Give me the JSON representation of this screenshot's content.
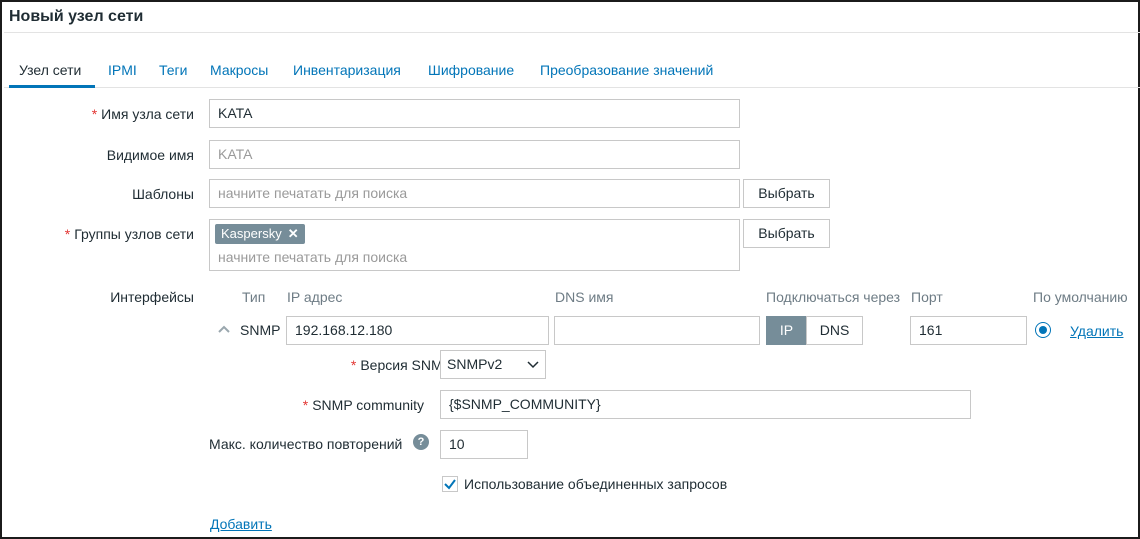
{
  "page": {
    "title": "Новый узел сети"
  },
  "tabs": [
    {
      "label": "Узел сети"
    },
    {
      "label": "IPMI"
    },
    {
      "label": "Теги"
    },
    {
      "label": "Макросы"
    },
    {
      "label": "Инвентаризация"
    },
    {
      "label": "Шифрование"
    },
    {
      "label": "Преобразование значений"
    }
  ],
  "form": {
    "required_mark": "*",
    "hostname": {
      "label": "Имя узла сети",
      "value": "KATA"
    },
    "visible_name": {
      "label": "Видимое имя",
      "placeholder": "KATA"
    },
    "templates": {
      "label": "Шаблоны",
      "placeholder": "начните печатать для поиска",
      "select_label": "Выбрать"
    },
    "groups": {
      "label": "Группы узлов сети",
      "chip": "Kaspersky",
      "chip_remove": "✕",
      "placeholder": "начните печатать для поиска",
      "select_label": "Выбрать"
    },
    "interfaces": {
      "label": "Интерфейсы",
      "headers": {
        "type": "Тип",
        "ip": "IP адрес",
        "dns": "DNS имя",
        "connect": "Подключаться через",
        "port": "Порт",
        "default": "По умолчанию"
      },
      "row": {
        "type": "SNMP",
        "ip": "192.168.12.180",
        "dns": "",
        "connect_ip": "IP",
        "connect_dns": "DNS",
        "port": "161",
        "remove": "Удалить"
      },
      "snmp_version": {
        "label": "Версия SNMP",
        "value": "SNMPv2"
      },
      "snmp_community": {
        "label": "SNMP community",
        "value": "{$SNMP_COMMUNITY}"
      },
      "max_repetitions": {
        "label": "Макс. количество повторений",
        "value": "10",
        "help": "?"
      },
      "bulk": {
        "label": "Использование объединенных запросов",
        "checked": true
      },
      "add_link": "Добавить"
    }
  }
}
